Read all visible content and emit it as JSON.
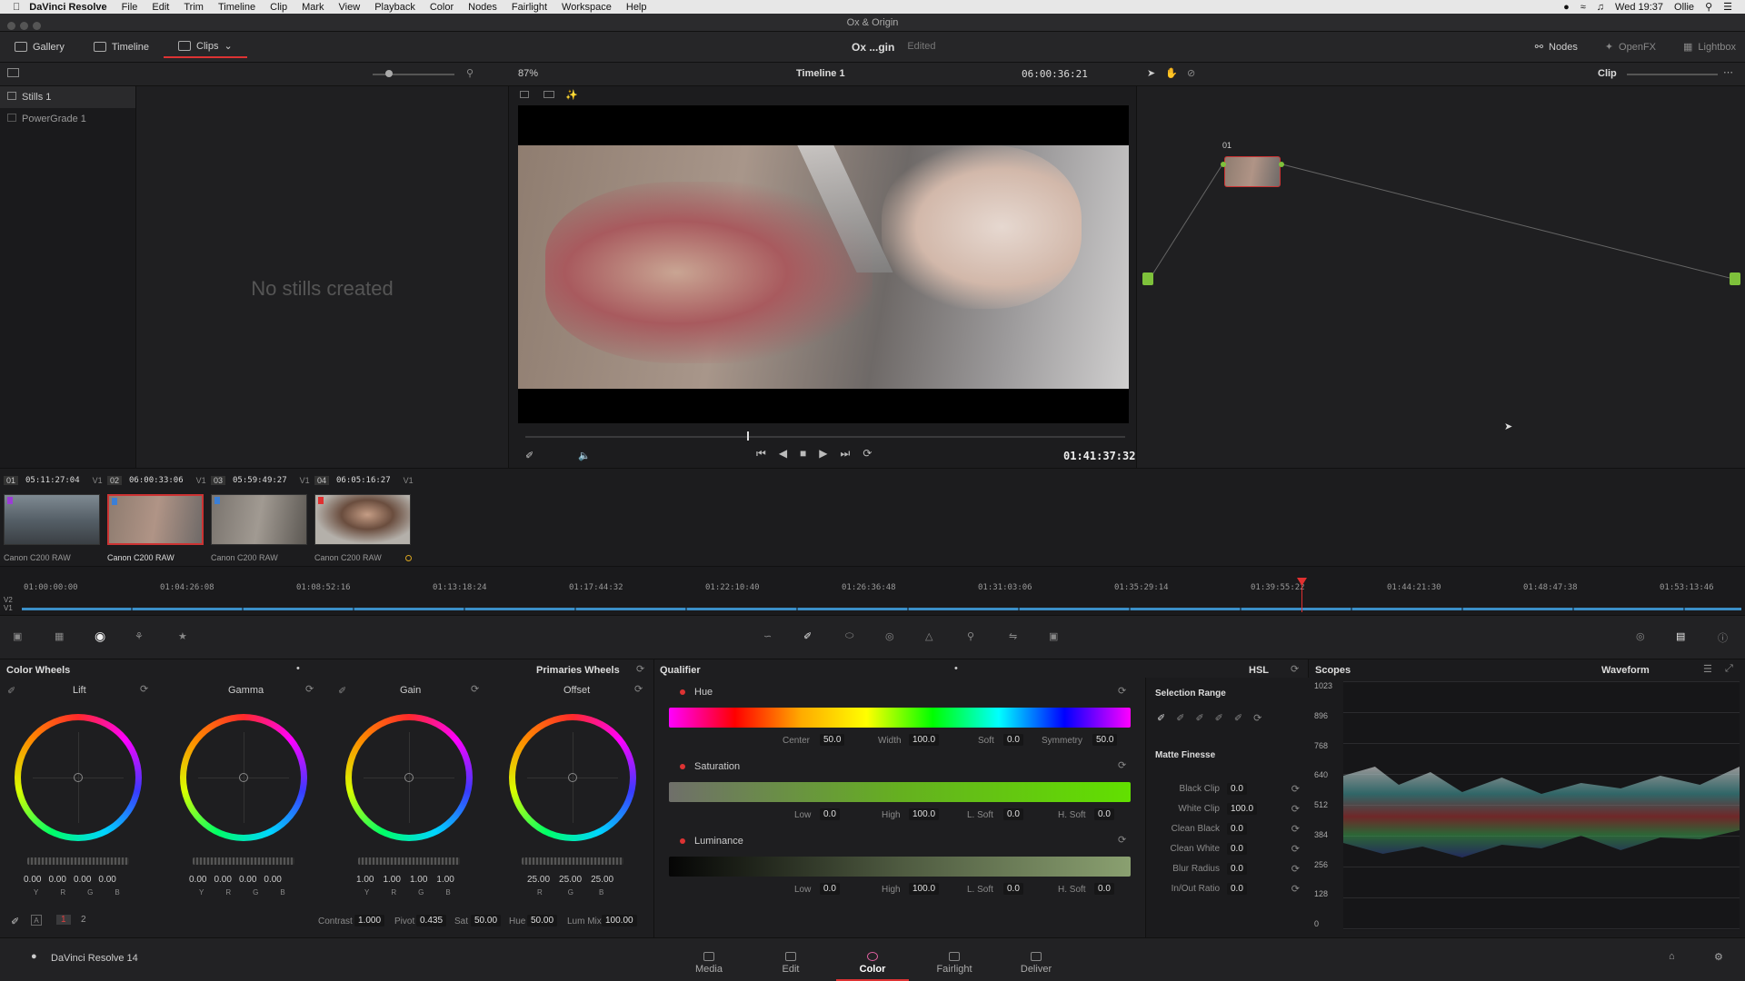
{
  "menubar": {
    "app": "DaVinci Resolve",
    "items": [
      "File",
      "Edit",
      "Trim",
      "Timeline",
      "Clip",
      "Mark",
      "View",
      "Playback",
      "Color",
      "Nodes",
      "Fairlight",
      "Workspace",
      "Help"
    ],
    "clock": "Wed 19:37",
    "user": "Ollie"
  },
  "window": {
    "title": "Ox & Origin"
  },
  "toolbar": {
    "gallery": "Gallery",
    "timeline": "Timeline",
    "clips": "Clips",
    "project": "Ox ...gin",
    "status": "Edited",
    "nodes": "Nodes",
    "openfx": "OpenFX",
    "lightbox": "Lightbox"
  },
  "subbar": {
    "zoom": "87%",
    "timeline_name": "Timeline 1",
    "timecode": "06:00:36:21",
    "mode": "Clip"
  },
  "gallery": {
    "items": [
      "Stills 1",
      "PowerGrade 1"
    ],
    "empty": "No stills created"
  },
  "viewer": {
    "timecode": "01:41:37:32"
  },
  "nodes": {
    "node_label": "01"
  },
  "clips": [
    {
      "num": "01",
      "tc": "05:11:27:04",
      "track": "V1",
      "name": "Canon C200 RAW",
      "flag": "#9b3bd6"
    },
    {
      "num": "02",
      "tc": "06:00:33:06",
      "track": "V1",
      "name": "Canon C200 RAW",
      "flag": "#3b7fd6"
    },
    {
      "num": "03",
      "tc": "05:59:49:27",
      "track": "V1",
      "name": "Canon C200 RAW",
      "flag": "#3b7fd6"
    },
    {
      "num": "04",
      "tc": "06:05:16:27",
      "track": "V1",
      "name": "Canon C200 RAW",
      "flag": "#e03030"
    }
  ],
  "timeline": {
    "ticks": [
      "01:00:00:00",
      "01:04:26:08",
      "01:08:52:16",
      "01:13:18:24",
      "01:17:44:32",
      "01:22:10:40",
      "01:26:36:48",
      "01:31:03:06",
      "01:35:29:14",
      "01:39:55:22",
      "01:44:21:30",
      "01:48:47:38",
      "01:53:13:46"
    ],
    "tracks": [
      "V2",
      "V1"
    ]
  },
  "color_wheels": {
    "title": "Color Wheels",
    "mode": "Primaries Wheels",
    "wheels": [
      {
        "name": "Lift",
        "values": [
          "0.00",
          "0.00",
          "0.00",
          "0.00"
        ]
      },
      {
        "name": "Gamma",
        "values": [
          "0.00",
          "0.00",
          "0.00",
          "0.00"
        ]
      },
      {
        "name": "Gain",
        "values": [
          "1.00",
          "1.00",
          "1.00",
          "1.00"
        ]
      },
      {
        "name": "Offset",
        "values": [
          "25.00",
          "25.00",
          "25.00"
        ]
      }
    ],
    "channels4": [
      "Y",
      "R",
      "G",
      "B"
    ],
    "channels3": [
      "R",
      "G",
      "B"
    ],
    "pages": [
      "1",
      "2"
    ],
    "contrast_label": "Contrast",
    "contrast": "1.000",
    "pivot_label": "Pivot",
    "pivot": "0.435",
    "sat_label": "Sat",
    "sat": "50.00",
    "hue_label": "Hue",
    "hue": "50.00",
    "lummix_label": "Lum Mix",
    "lummix": "100.00"
  },
  "qualifier": {
    "title": "Qualifier",
    "mode": "HSL",
    "hue": {
      "label": "Hue",
      "center_label": "Center",
      "center": "50.0",
      "width_label": "Width",
      "width": "100.0",
      "soft_label": "Soft",
      "soft": "0.0",
      "sym_label": "Symmetry",
      "sym": "50.0"
    },
    "saturation": {
      "label": "Saturation",
      "low_label": "Low",
      "low": "0.0",
      "high_label": "High",
      "high": "100.0",
      "lsoft_label": "L. Soft",
      "lsoft": "0.0",
      "hsoft_label": "H. Soft",
      "hsoft": "0.0"
    },
    "luminance": {
      "label": "Luminance",
      "low_label": "Low",
      "low": "0.0",
      "high_label": "High",
      "high": "100.0",
      "lsoft_label": "L. Soft",
      "lsoft": "0.0",
      "hsoft_label": "H. Soft",
      "hsoft": "0.0"
    },
    "selection_range": "Selection Range",
    "matte_finesse": "Matte Finesse",
    "matte": [
      {
        "label": "Black Clip",
        "value": "0.0"
      },
      {
        "label": "White Clip",
        "value": "100.0"
      },
      {
        "label": "Clean Black",
        "value": "0.0"
      },
      {
        "label": "Clean White",
        "value": "0.0"
      },
      {
        "label": "Blur Radius",
        "value": "0.0"
      },
      {
        "label": "In/Out Ratio",
        "value": "0.0"
      }
    ]
  },
  "scopes": {
    "title": "Scopes",
    "mode": "Waveform",
    "scale": [
      "1023",
      "896",
      "768",
      "640",
      "512",
      "384",
      "256",
      "128",
      "0"
    ]
  },
  "bottom": {
    "app": "DaVinci Resolve 14",
    "pages": [
      "Media",
      "Edit",
      "Color",
      "Fairlight",
      "Deliver"
    ],
    "active": "Color"
  }
}
